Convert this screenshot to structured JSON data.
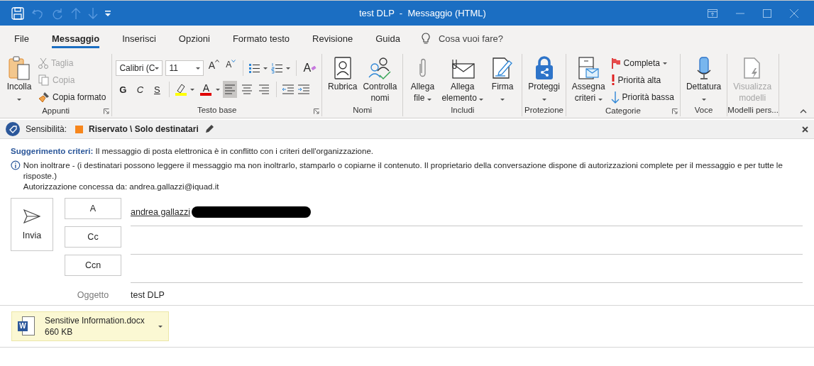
{
  "window": {
    "title": "test DLP  -  Messaggio (HTML)"
  },
  "tabs": [
    {
      "label": "File",
      "selected": false
    },
    {
      "label": "Messaggio",
      "selected": true
    },
    {
      "label": "Inserisci",
      "selected": false
    },
    {
      "label": "Opzioni",
      "selected": false
    },
    {
      "label": "Formato testo",
      "selected": false
    },
    {
      "label": "Revisione",
      "selected": false
    },
    {
      "label": "Guida",
      "selected": false
    }
  ],
  "tell_me": {
    "placeholder": "Cosa vuoi fare?"
  },
  "ribbon": {
    "groups": [
      {
        "label": "Appunti",
        "launcher": true,
        "items": [
          {
            "kind": "large",
            "lines": [
              "Incolla"
            ],
            "caret": true,
            "disabled": false
          },
          {
            "kind": "stack",
            "items": [
              {
                "label": "Taglia",
                "disabled": true,
                "caret": false
              },
              {
                "label": "Copia",
                "disabled": true,
                "caret": false
              },
              {
                "label": "Copia formato",
                "disabled": false,
                "caret": false
              }
            ]
          }
        ]
      },
      {
        "label": "Testo base",
        "launcher": true,
        "items": [
          {
            "kind": "font_tools",
            "font": "Calibri (C",
            "size": "11",
            "grow": "A",
            "shrink": "A",
            "clear": "A",
            "font_color": "A",
            "styles": [
              "G",
              "C",
              "S"
            ],
            "alignments": [
              {
                "selected": true
              },
              {
                "selected": false
              },
              {
                "selected": false
              }
            ]
          }
        ]
      },
      {
        "label": "Nomi",
        "launcher": false,
        "items": [
          {
            "kind": "large",
            "lines": [
              "Rubrica"
            ],
            "caret": false,
            "disabled": false
          },
          {
            "kind": "large",
            "lines": [
              "Controlla",
              "nomi"
            ],
            "caret": false,
            "disabled": false
          }
        ]
      },
      {
        "label": "Includi",
        "launcher": false,
        "items": [
          {
            "kind": "large",
            "lines": [
              "Allega",
              "file"
            ],
            "caret": true,
            "disabled": false
          },
          {
            "kind": "large",
            "lines": [
              "Allega",
              "elemento"
            ],
            "caret": true,
            "disabled": false
          },
          {
            "kind": "large",
            "lines": [
              "Firma"
            ],
            "caret": true,
            "disabled": false
          }
        ]
      },
      {
        "label": "Protezione",
        "launcher": false,
        "items": [
          {
            "kind": "large",
            "lines": [
              "Proteggi"
            ],
            "caret": true,
            "disabled": false
          }
        ]
      },
      {
        "label": "Categorie",
        "launcher": true,
        "items": [
          {
            "kind": "large",
            "lines": [
              "Assegna",
              "criteri"
            ],
            "caret": true,
            "disabled": false
          },
          {
            "kind": "stack",
            "items": [
              {
                "label": "Completa",
                "disabled": false,
                "caret": true
              },
              {
                "label": "Priorità alta",
                "disabled": false,
                "caret": false
              },
              {
                "label": "Priorità bassa",
                "disabled": false,
                "caret": false
              }
            ]
          }
        ]
      },
      {
        "label": "Voce",
        "launcher": false,
        "items": [
          {
            "kind": "large",
            "lines": [
              "Dettatura"
            ],
            "caret": true,
            "disabled": false
          }
        ]
      },
      {
        "label": "Modelli pers...",
        "launcher": false,
        "items": [
          {
            "kind": "large",
            "lines": [
              "Visualizza",
              "modelli"
            ],
            "caret": false,
            "disabled": true
          }
        ]
      }
    ]
  },
  "sensitivity": {
    "label": "Sensibilità:",
    "value": "Riservato \\ Solo destinatari",
    "color": "#f7861c"
  },
  "policy_tip": {
    "text": "**Suggerimento criteri:** Il messaggio di posta elettronica è in conflitto con i criteri dell'organizzazione.",
    "info": "Non inoltrare - (i destinatari possono leggere il messaggio ma non inoltrarlo, stamparlo o copiarne il contenuto. Il proprietario della conversazione dispone di autorizzazioni complete per il messaggio e per tutte le risposte.)",
    "granted_by": "Autorizzazione concessa da: andrea.gallazzi@iquad.it"
  },
  "send_button": {
    "label": "Invia"
  },
  "fields": [
    {
      "label": "A",
      "value": "andrea gallazzi",
      "redacted": true
    },
    {
      "label": "Cc",
      "redacted": false
    },
    {
      "label": "Ccn",
      "redacted": false
    }
  ],
  "subject": {
    "label": "Oggetto",
    "value": "test DLP"
  },
  "attachments": [
    {
      "name": "Sensitive Information.docx",
      "size": "660 KB",
      "icon_letter": "W"
    }
  ]
}
